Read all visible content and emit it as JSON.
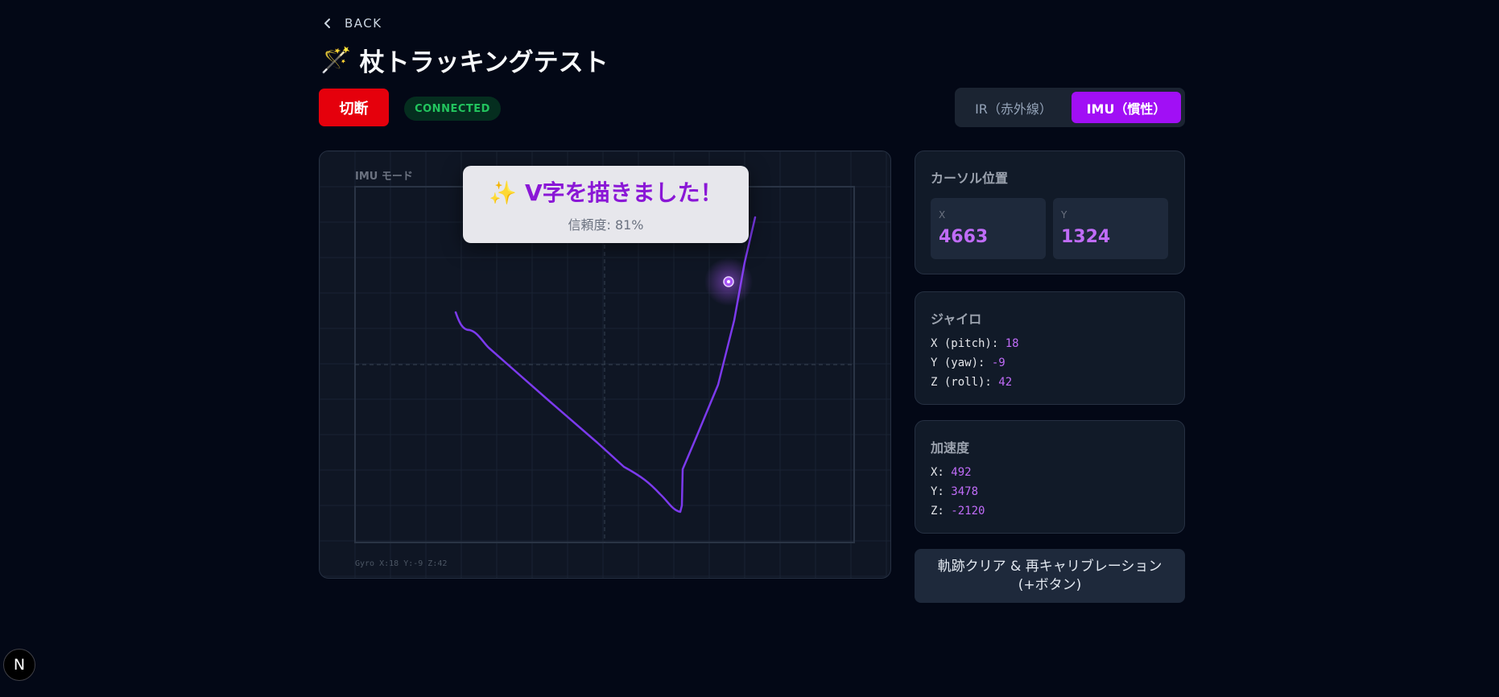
{
  "nav": {
    "back_label": "BACK"
  },
  "header": {
    "title_emoji": "🪄",
    "title": "杖トラッキングテスト"
  },
  "controls": {
    "disconnect_label": "切断",
    "status_label": "CONNECTED",
    "modes": [
      {
        "label": "IR（赤外線）",
        "active": false
      },
      {
        "label": "IMU（慣性）",
        "active": true
      }
    ]
  },
  "canvas": {
    "mode_label": "IMU モード",
    "gyro_readout": "Gyro  X:18  Y:-9  Z:42",
    "trail_color": "#7c3aed",
    "cursor_color": "#a855f7",
    "toast": {
      "title": "✨ V字を描きました！",
      "subtitle": "信頼度: 81%"
    }
  },
  "cursor": {
    "title": "カーソル位置",
    "x_label": "X",
    "x_value": "4663",
    "y_label": "Y",
    "y_value": "1324"
  },
  "gyro": {
    "title": "ジャイロ",
    "items": [
      {
        "label": "X (pitch): ",
        "value": "18"
      },
      {
        "label": "Y (yaw): ",
        "value": "-9"
      },
      {
        "label": "Z (roll): ",
        "value": "42"
      }
    ]
  },
  "accel": {
    "title": "加速度",
    "items": [
      {
        "label": "X: ",
        "value": "492"
      },
      {
        "label": "Y: ",
        "value": "3478"
      },
      {
        "label": "Z: ",
        "value": "-2120"
      }
    ]
  },
  "action": {
    "line1": "軌跡クリア & 再キャリブレーション",
    "line2": "(+ボタン)"
  },
  "colors": {
    "accent": "#a10ff5",
    "danger": "#e5000c",
    "success": "#22c55e",
    "value": "#c06cf8"
  }
}
